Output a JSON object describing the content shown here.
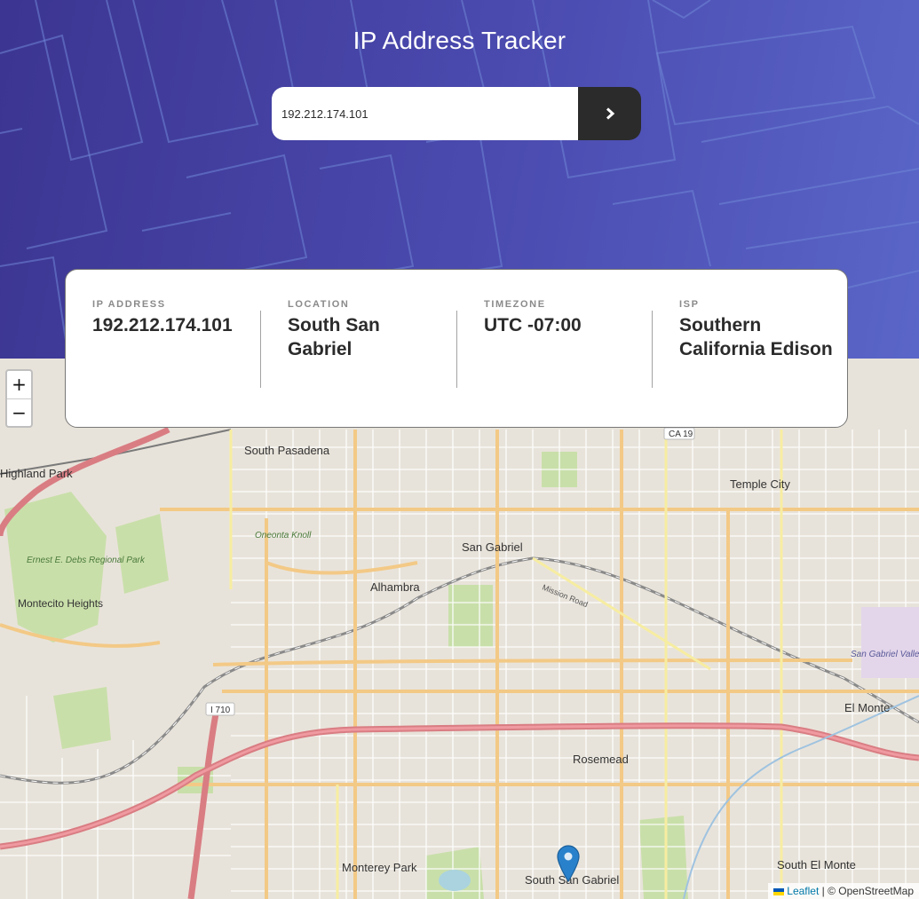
{
  "app": {
    "title": "IP Address Tracker"
  },
  "search": {
    "value": "192.212.174.101",
    "button_icon": "chevron-right-icon"
  },
  "info": {
    "ip": {
      "label": "IP ADDRESS",
      "value": "192.212.174.101"
    },
    "location": {
      "label": "LOCATION",
      "value": "South San Gabriel"
    },
    "timezone": {
      "label": "TIMEZONE",
      "value": "UTC -07:00"
    },
    "isp": {
      "label": "ISP",
      "value": "Southern California Edison"
    }
  },
  "map": {
    "zoom_in": "+",
    "zoom_out": "−",
    "attribution": {
      "leaflet": "Leaflet",
      "separator": " | © ",
      "osm": "OpenStreetMap"
    },
    "places": {
      "south_pasadena": "South Pasadena",
      "highland_park": "Highland Park",
      "temple_city": "Temple City",
      "oneonta_knoll": "Oneonta Knoll",
      "san_gabriel": "San Gabriel",
      "ernest_debs": "Ernest E. Debs Regional Park",
      "alhambra": "Alhambra",
      "mission_road": "Mission Road",
      "montecito_heights": "Montecito Heights",
      "sg_valley_airport": "San Gabriel Valley Airport",
      "el_monte": "El Monte",
      "rosemead": "Rosemead",
      "monterey_park": "Monterey Park",
      "south_san_gabriel": "South San Gabriel",
      "south_el_monte": "South El Monte"
    },
    "shields": {
      "ca19": "CA 19",
      "i710": "I 710"
    }
  },
  "colors": {
    "header_start": "#3c3591",
    "header_end": "#5a66c8",
    "button": "#2b2b2b",
    "marker": "#2a81cb"
  }
}
